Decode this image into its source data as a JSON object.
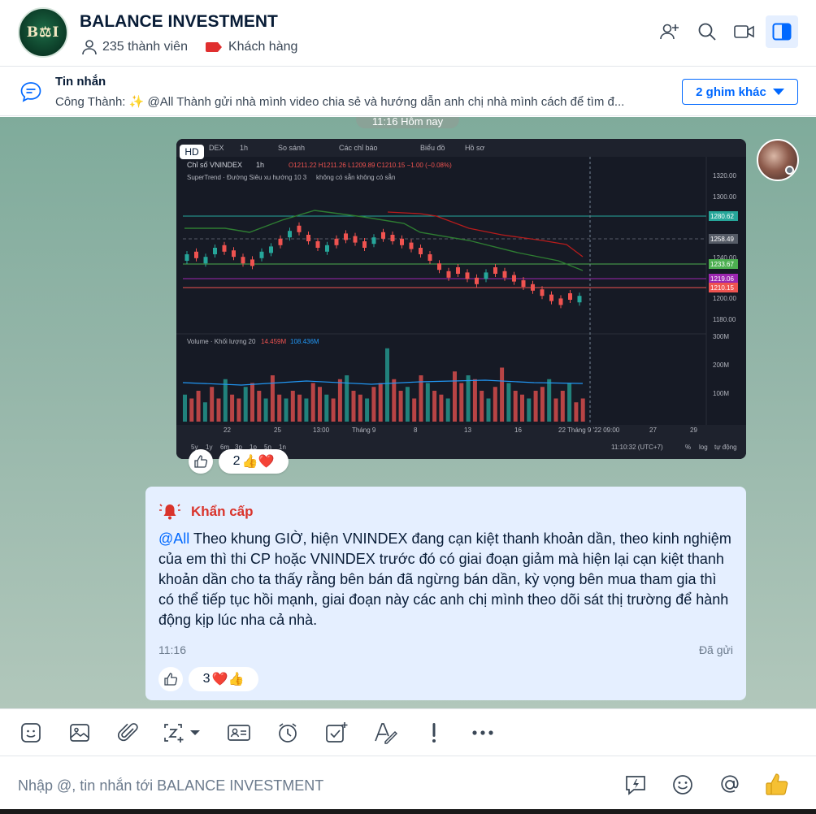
{
  "header": {
    "avatar_text": "B⚖I",
    "title": "BALANCE INVESTMENT",
    "members": "235 thành viên",
    "tag": "Khách hàng",
    "icons": [
      "add-member-icon",
      "search-icon",
      "video-call-icon",
      "sidebar-toggle-icon"
    ]
  },
  "pinned": {
    "title": "Tin nhắn",
    "text": "Công Thành: ✨ @All Thành gửi nhà mình video chia sẻ và hướng dẫn anh chị nhà mình cách để tìm đ...",
    "more_label": "2 ghim khác"
  },
  "chat": {
    "time_divider": "11:16 Hôm nay",
    "image_badge": "HD",
    "image_reaction": {
      "count": "2",
      "emojis": "👍❤️"
    },
    "message": {
      "alert_label": "Khẩn cấp",
      "mention": "@All",
      "text": " Theo khung GIỜ, hiện VNINDEX đang cạn kiệt thanh khoản dần, theo kinh nghiệm của em thì thi CP hoặc VNINDEX trước đó có giai đoạn giảm mà hiện lại cạn kiệt thanh khoản dần cho ta thấy rằng bên bán đã ngừng bán dần, kỳ vọng bên mua tham gia thì có thể tiếp tục hồi mạnh, giai đoạn này các anh chị mình theo dõi sát thị trường để hành động kịp lúc nha cả nhà.",
      "time": "11:16",
      "status": "Đã gửi",
      "reaction": {
        "count": "3",
        "emojis": "❤️👍"
      }
    }
  },
  "chart_image": {
    "toolbar": [
      "DEX",
      "1h",
      "So sánh",
      "Các chỉ báo",
      "Biểu đồ",
      "Hồ sơ"
    ],
    "title": "Chỉ số VNINDEX",
    "interval": "1h",
    "ohlc": "O1211.22 H1211.26 L1209.89 C1210.15 −1.00 (−0.08%)",
    "indicator": "SuperTrend · Đường Siêu xu hướng 10 3",
    "indicator_values": "không có sẵn  không có sẵn",
    "price_ticks": [
      "1320.00",
      "1300.00",
      "1240.00",
      "1200.00",
      "1180.00"
    ],
    "price_labels": [
      {
        "value": "1280.62",
        "color": "#26a69a"
      },
      {
        "value": "1258.49",
        "color": "#555b66"
      },
      {
        "value": "1233.67",
        "color": "#4caf50"
      },
      {
        "value": "1219.06",
        "color": "#9c27b0"
      },
      {
        "value": "1210.15",
        "color": "#ef5350"
      }
    ],
    "volume_label": "Volume · Khối lượng 20",
    "volume_val1": "14.459M",
    "volume_val2": "108.436M",
    "volume_ticks": [
      "300M",
      "200M",
      "100M"
    ],
    "x_ticks": [
      "22",
      "25",
      "13:00",
      "Tháng 9",
      "8",
      "13",
      "16",
      "22 Tháng 9 '22  09:00",
      "27",
      "29"
    ],
    "ranges": [
      "5y",
      "1y",
      "6m",
      "3p",
      "1p",
      "5n",
      "1n"
    ],
    "clock": "11:10:32 (UTC+7)",
    "scale_opts": [
      "%",
      "log",
      "tự động"
    ]
  },
  "composer": {
    "placeholder": "Nhập @, tin nhắn tới BALANCE INVESTMENT",
    "icons": [
      "quick-message-icon",
      "emoji-icon",
      "mention-icon",
      "thumbs-up-icon"
    ]
  },
  "toolbar": {
    "icons": [
      "sticker-icon",
      "image-icon",
      "attachment-icon",
      "screenshot-icon",
      "contact-card-icon",
      "reminder-icon",
      "task-icon",
      "text-format-icon",
      "urgent-icon",
      "more-icon"
    ]
  }
}
